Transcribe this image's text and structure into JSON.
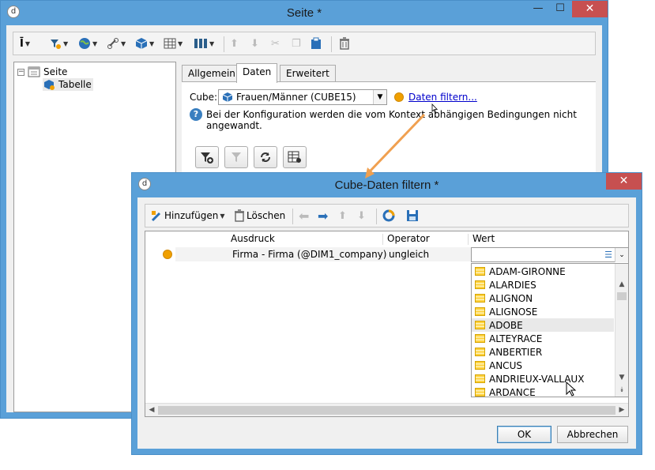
{
  "outer_window": {
    "title": "Seite *",
    "toolbar_icons": [
      "insert-icon",
      "filter-icon",
      "globe-icon",
      "link-icon",
      "cube-icon",
      "table-icon",
      "columns-icon",
      "move-up-icon",
      "move-down-icon",
      "cut-icon",
      "copy-icon",
      "paste-icon",
      "delete-icon"
    ]
  },
  "tree": {
    "root_label": "Seite",
    "child_label": "Tabelle"
  },
  "tabs": [
    "Allgemein",
    "Daten",
    "Erweitert"
  ],
  "daten": {
    "cube_label": "Cube:",
    "cube_value": "Frauen/Männer (CUBE15)",
    "filter_link": "Daten filtern...",
    "info_text": "Bei der Konfiguration werden die vom Kontext abhängigen Bedingungen nicht angewandt."
  },
  "dialog": {
    "title": "Cube-Daten filtern *",
    "add_label": "Hinzufügen",
    "delete_label": "Löschen",
    "columns": [
      "Ausdruck",
      "Operator",
      "Wert"
    ],
    "row": {
      "expression": "Firma - Firma (@DIM1_company)",
      "operator": "ungleich",
      "value": ""
    },
    "dropdown_items": [
      "ADAM-GIRONNE",
      "ALARDIES",
      "ALIGNON",
      "ALIGNOSE",
      "ADOBE",
      "ALTEYRACE",
      "ANBERTIER",
      "ANCUS",
      "ANDRIEUX-VALLAUX",
      "ARDANCE"
    ],
    "hovered_item": "ADOBE",
    "ok_label": "OK",
    "cancel_label": "Abbrechen"
  },
  "colors": {
    "title_bar": "#5aa0d8",
    "close_button": "#c75050",
    "accent_orange": "#f0a000",
    "arrow": "#f0a050"
  }
}
